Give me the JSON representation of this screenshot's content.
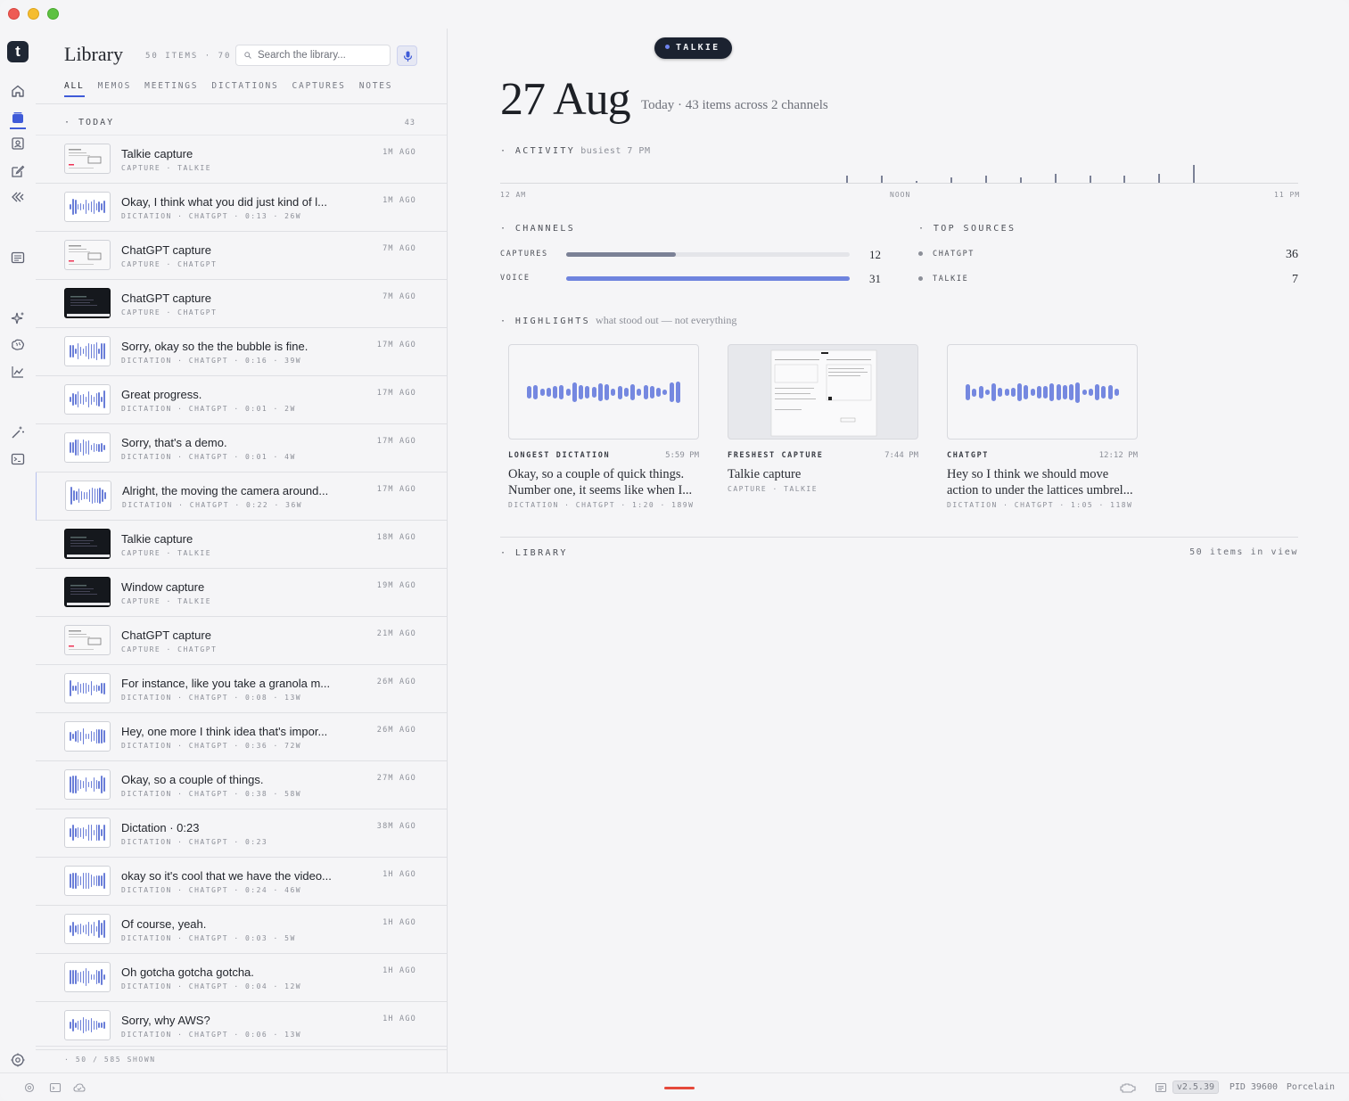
{
  "library": {
    "title": "Library",
    "count": "50 ITEMS · 70",
    "search_placeholder": "Search the library...",
    "tabs": [
      "ALL",
      "MEMOS",
      "MEETINGS",
      "DICTATIONS",
      "CAPTURES",
      "NOTES"
    ],
    "active_tab": "ALL",
    "group_label": "· TODAY",
    "group_count": "43",
    "footer": "· 50 / 585 SHOWN",
    "items": [
      {
        "title": "Talkie capture",
        "meta": "CAPTURE · TALKIE",
        "ago": "1M AGO",
        "kind": "shot"
      },
      {
        "title": "Okay, I think what you did just kind of l...",
        "meta": "DICTATION · CHATGPT · 0:13 · 26W",
        "ago": "1M AGO",
        "kind": "wave"
      },
      {
        "title": "ChatGPT capture",
        "meta": "CAPTURE · CHATGPT",
        "ago": "7M AGO",
        "kind": "shot"
      },
      {
        "title": "ChatGPT capture",
        "meta": "CAPTURE · CHATGPT",
        "ago": "7M AGO",
        "kind": "dark"
      },
      {
        "title": "Sorry, okay so the the bubble is fine.",
        "meta": "DICTATION · CHATGPT · 0:16 · 39W",
        "ago": "17M AGO",
        "kind": "wave"
      },
      {
        "title": "Great progress.",
        "meta": "DICTATION · CHATGPT · 0:01 · 2W",
        "ago": "17M AGO",
        "kind": "wave"
      },
      {
        "title": "Sorry, that's a demo.",
        "meta": "DICTATION · CHATGPT · 0:01 · 4W",
        "ago": "17M AGO",
        "kind": "wave"
      },
      {
        "title": "Alright, the moving the camera around...",
        "meta": "DICTATION · CHATGPT · 0:22 · 36W",
        "ago": "17M AGO",
        "kind": "wave",
        "highlighted": true
      },
      {
        "title": "Talkie capture",
        "meta": "CAPTURE · TALKIE",
        "ago": "18M AGO",
        "kind": "dark"
      },
      {
        "title": "Window capture",
        "meta": "CAPTURE · TALKIE",
        "ago": "19M AGO",
        "kind": "dark"
      },
      {
        "title": "ChatGPT capture",
        "meta": "CAPTURE · CHATGPT",
        "ago": "21M AGO",
        "kind": "shot"
      },
      {
        "title": "For instance, like you take a granola m...",
        "meta": "DICTATION · CHATGPT · 0:08 · 13W",
        "ago": "26M AGO",
        "kind": "wave"
      },
      {
        "title": "Hey, one more I think idea that's impor...",
        "meta": "DICTATION · CHATGPT · 0:36 · 72W",
        "ago": "26M AGO",
        "kind": "wave"
      },
      {
        "title": "Okay, so a couple of things.",
        "meta": "DICTATION · CHATGPT · 0:38 · 58W",
        "ago": "27M AGO",
        "kind": "wave"
      },
      {
        "title": "Dictation · 0:23",
        "meta": "DICTATION · CHATGPT · 0:23",
        "ago": "38M AGO",
        "kind": "wave"
      },
      {
        "title": "okay so it's cool that we have the video...",
        "meta": "DICTATION · CHATGPT · 0:24 · 46W",
        "ago": "1H AGO",
        "kind": "wave"
      },
      {
        "title": "Of course, yeah.",
        "meta": "DICTATION · CHATGPT · 0:03 · 5W",
        "ago": "1H AGO",
        "kind": "wave"
      },
      {
        "title": "Oh gotcha gotcha gotcha.",
        "meta": "DICTATION · CHATGPT · 0:04 · 12W",
        "ago": "1H AGO",
        "kind": "wave"
      },
      {
        "title": "Sorry, why AWS?",
        "meta": "DICTATION · CHATGPT · 0:06 · 13W",
        "ago": "1H AGO",
        "kind": "wave"
      }
    ]
  },
  "main": {
    "pill": "TALKIE",
    "date": "27 Aug",
    "date_sub": "Today · 43 items across 2 channels",
    "activity": {
      "label": "· ACTIVITY",
      "extra": "busiest 7 PM",
      "axis": [
        "12 AM",
        "NOON",
        "11 PM"
      ],
      "chart_data": {
        "type": "bar",
        "x_range": [
          "12 AM",
          "11 PM"
        ],
        "hours": [
          10,
          11,
          12,
          13,
          14,
          15,
          16,
          17,
          18,
          19,
          20,
          21,
          22,
          23
        ],
        "values": [
          4,
          4,
          1,
          3,
          4,
          3,
          5,
          4,
          4,
          5,
          10,
          0,
          0,
          0
        ]
      }
    },
    "channels": {
      "label": "· CHANNELS",
      "rows": [
        {
          "name": "CAPTURES",
          "value": "12",
          "fraction": 0.387,
          "color": "#7b8196"
        },
        {
          "name": "VOICE",
          "value": "31",
          "fraction": 1.0,
          "color": "#6f84de"
        }
      ]
    },
    "top_sources": {
      "label": "· TOP SOURCES",
      "rows": [
        {
          "name": "CHATGPT",
          "value": "36"
        },
        {
          "name": "TALKIE",
          "value": "7"
        }
      ]
    },
    "highlights": {
      "label": "· HIGHLIGHTS",
      "extra": "what stood out — not everything",
      "cards": [
        {
          "kicker": "LONGEST DICTATION",
          "time": "5:59 PM",
          "body": "Okay, so a couple of quick things. Number one, it seems like when I...",
          "meta": "DICTATION · CHATGPT · 1:20 · 189W",
          "kind": "wave"
        },
        {
          "kicker": "FRESHEST CAPTURE",
          "time": "7:44 PM",
          "body": "Talkie capture",
          "meta": "CAPTURE · TALKIE",
          "kind": "shot"
        },
        {
          "kicker": "CHATGPT",
          "time": "12:12 PM",
          "body": "Hey so I think we should move action to under the lattices umbrel...",
          "meta": "DICTATION · CHATGPT · 1:05 · 118W",
          "kind": "wave"
        }
      ]
    },
    "library_section": {
      "label": "· LIBRARY",
      "extra": "50 items in view"
    }
  },
  "status": {
    "version": "v2.5.39",
    "pid": "PID 39600",
    "theme": "Porcelain",
    "colors": {
      "accent": "#3f5bd8",
      "record": "#e5483b"
    }
  }
}
